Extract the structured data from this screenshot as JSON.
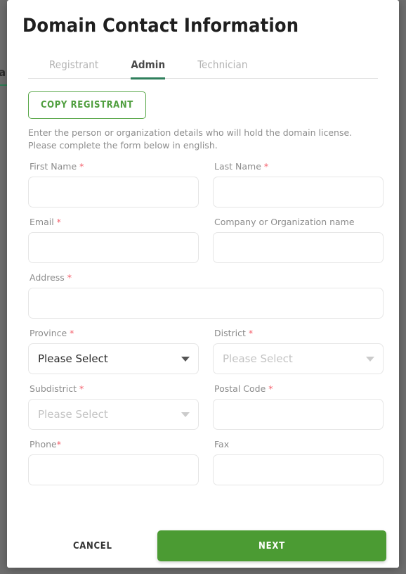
{
  "background": {
    "overlay_color": "#6e6e6e",
    "fragment_text": "a"
  },
  "modal": {
    "title": "Domain Contact Information",
    "accent_green": "#4b9b33",
    "tab_underline_color": "#2f7f5c"
  },
  "tabs": [
    {
      "label": "Registrant",
      "active": false
    },
    {
      "label": "Admin",
      "active": true
    },
    {
      "label": "Technician",
      "active": false
    }
  ],
  "actions": {
    "copy_registrant_label": "COPY REGISTRANT"
  },
  "helper": {
    "line1": "Enter the person or organization details who will hold the domain license.",
    "line2": "Please complete the form below in english."
  },
  "form": {
    "first_name": {
      "label": "First Name",
      "required": true,
      "value": "",
      "placeholder": ""
    },
    "last_name": {
      "label": "Last Name",
      "required": true,
      "value": "",
      "placeholder": ""
    },
    "email": {
      "label": "Email",
      "required": true,
      "value": "",
      "placeholder": ""
    },
    "company": {
      "label": "Company or Organization name",
      "required": false,
      "value": "",
      "placeholder": ""
    },
    "address": {
      "label": "Address",
      "required": true,
      "value": "",
      "placeholder": ""
    },
    "province": {
      "label": "Province",
      "required": true,
      "selected": "Please Select",
      "enabled": true
    },
    "district": {
      "label": "District",
      "required": true,
      "selected": "Please Select",
      "enabled": false
    },
    "subdistrict": {
      "label": "Subdistrict",
      "required": true,
      "selected": "Please Select",
      "enabled": false
    },
    "postal_code": {
      "label": "Postal Code",
      "required": true,
      "value": "",
      "placeholder": ""
    },
    "phone": {
      "label": "Phone",
      "required": true,
      "required_no_space": true,
      "value": "",
      "placeholder": ""
    },
    "fax": {
      "label": "Fax",
      "required": false,
      "value": "",
      "placeholder": ""
    }
  },
  "footer": {
    "cancel_label": "CANCEL",
    "next_label": "NEXT"
  },
  "required_marker": "*"
}
